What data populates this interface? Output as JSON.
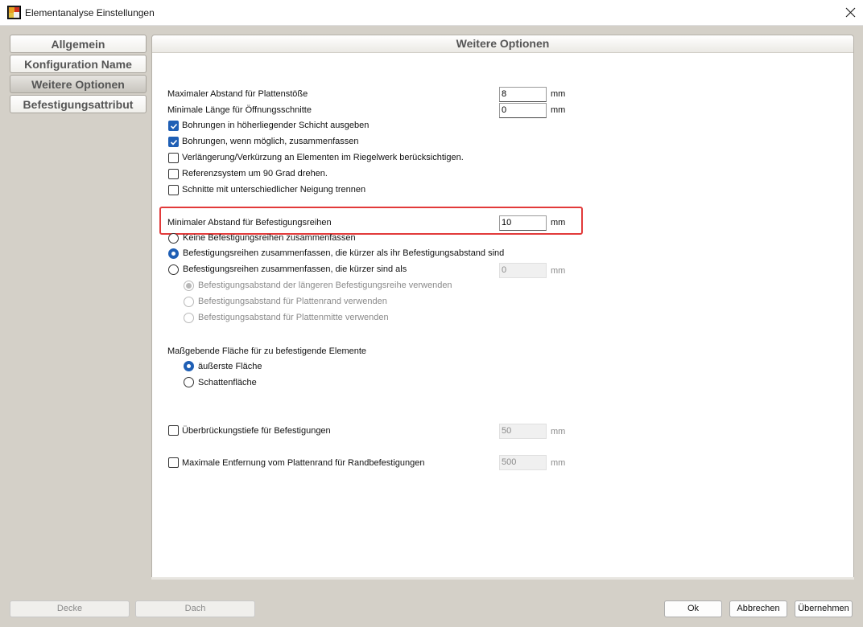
{
  "window": {
    "title": "Elementanalyse Einstellungen"
  },
  "nav": {
    "items": [
      {
        "label": "Allgemein"
      },
      {
        "label": "Konfiguration Name"
      },
      {
        "label": "Weitere Optionen"
      },
      {
        "label": "Befestigungsattribut"
      }
    ],
    "active_index": 2
  },
  "panel": {
    "title": "Weitere Optionen",
    "max_abstand": {
      "label": "Maximaler Abstand für Plattenstöße",
      "value": "8",
      "unit": "mm"
    },
    "min_laenge": {
      "label": "Minimale Länge für Öffnungsschnitte",
      "value": "0",
      "unit": "mm"
    },
    "checkboxes": [
      {
        "label": "Bohrungen in höherliegender Schicht ausgeben",
        "checked": true
      },
      {
        "label": "Bohrungen, wenn möglich, zusammenfassen",
        "checked": true
      },
      {
        "label": "Verlängerung/Verkürzung an Elementen im Riegelwerk berücksichtigen.",
        "checked": false
      },
      {
        "label": "Referenzsystem um 90 Grad drehen.",
        "checked": false
      },
      {
        "label": "Schnitte mit unterschiedlicher Neigung trennen",
        "checked": false
      }
    ],
    "min_befestigungsreihen": {
      "label": "Minimaler Abstand für Befestigungsreihen",
      "value": "10",
      "unit": "mm"
    },
    "reihen_radios": [
      {
        "label": "Keine Befestigungsreihen zusammenfassen",
        "selected": false
      },
      {
        "label": "Befestigungsreihen zusammenfassen, die kürzer als ihr Befestigungsabstand sind",
        "selected": true
      },
      {
        "label": "Befestigungsreihen zusammenfassen, die kürzer sind als",
        "selected": false,
        "value": "0",
        "unit": "mm"
      }
    ],
    "abstand_sub_radios": [
      {
        "label": "Befestigungsabstand der längeren Befestigungsreihe verwenden",
        "selected": true
      },
      {
        "label": "Befestigungsabstand für Plattenrand verwenden",
        "selected": false
      },
      {
        "label": "Befestigungsabstand für Plattenmitte verwenden",
        "selected": false
      }
    ],
    "flaeche": {
      "label": "Maßgebende Fläche für zu befestigende Elemente",
      "options": [
        {
          "label": "äußerste Fläche",
          "selected": true
        },
        {
          "label": "Schattenfläche",
          "selected": false
        }
      ]
    },
    "ueberbrueckung": {
      "label": "Überbrückungstiefe für Befestigungen",
      "checked": false,
      "value": "50",
      "unit": "mm"
    },
    "max_entfernung": {
      "label": "Maximale Entfernung vom Plattenrand für Randbefestigungen",
      "checked": false,
      "value": "500",
      "unit": "mm"
    }
  },
  "footer": {
    "decke_label": "Decke",
    "dach_label": "Dach",
    "ok_label": "Ok",
    "abbrechen_label": "Abbrechen",
    "uebernehmen_label": "Übernehmen"
  },
  "colors": {
    "accent": "#1f5fb5",
    "highlight": "#e23a3a"
  }
}
